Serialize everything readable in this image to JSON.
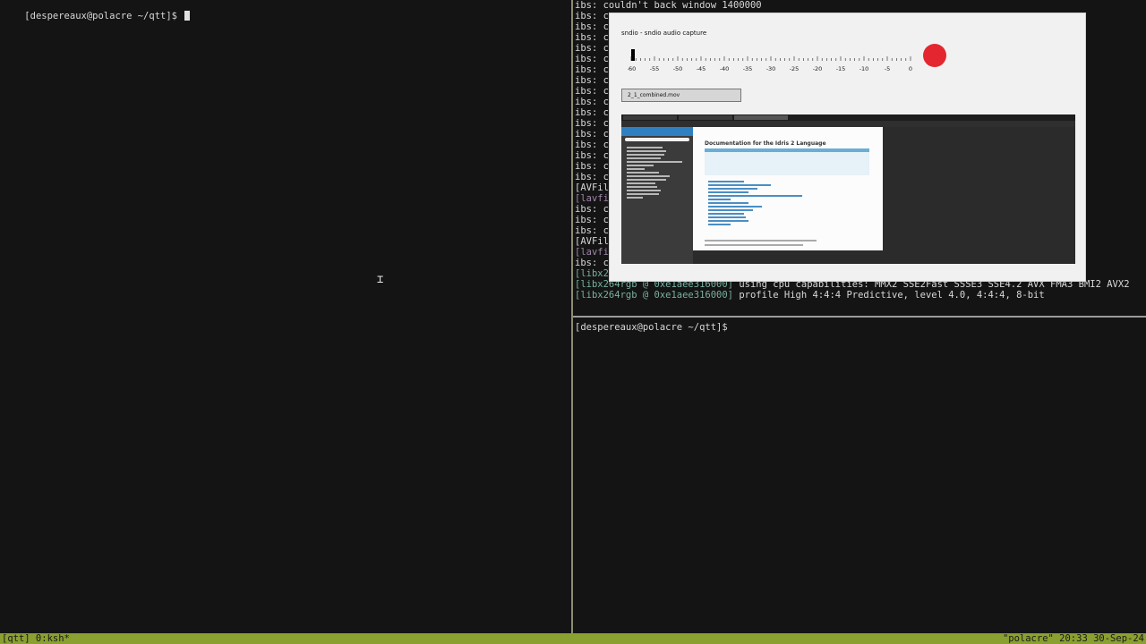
{
  "left_pane": {
    "prompt": "[despereaux@polacre ~/qtt]$ "
  },
  "right_top_pane": {
    "line0": "ibs: couldn't back window 1400000",
    "ibs_prefix": "ibs: c",
    "ibs_prefix_short": "ibs: co",
    "avfil": "[AVFil",
    "lavfi": "[lavfi",
    "libx": "[libx2",
    "libx_tag": "[libx264rgb @ 0xe1aee316000]",
    "libx_msg1": " using cpu capabilities: MMX2 SSE2Fast SSSE3 SSE4.2 AVX FMA3 BMI2 AVX2",
    "libx_msg2": " profile High 4:4:4 Predictive, level 4.0, 4:4:4, 8-bit"
  },
  "right_bottom_pane": {
    "prompt": "[despereaux@polacre ~/qtt]$"
  },
  "sndio_window": {
    "title": "sndio - sndio audio capture",
    "ticks": [
      "-60",
      "-55",
      "-50",
      "-45",
      "-40",
      "-35",
      "-30",
      "-25",
      "-20",
      "-15",
      "-10",
      "-5",
      "0"
    ],
    "filename": "2_1_combined.mov",
    "record_color": "#e3262f"
  },
  "preview": {
    "doc_title": "Documentation for the Idris 2 Language"
  },
  "status_bar": {
    "left": "[qtt] 0:ksh*",
    "right": "\"polacre\" 20:33 30-Sep-24"
  },
  "colors": {
    "status_bg": "#8aa030",
    "terminal_bg": "#141414",
    "accent_green": "#79b0a0"
  }
}
